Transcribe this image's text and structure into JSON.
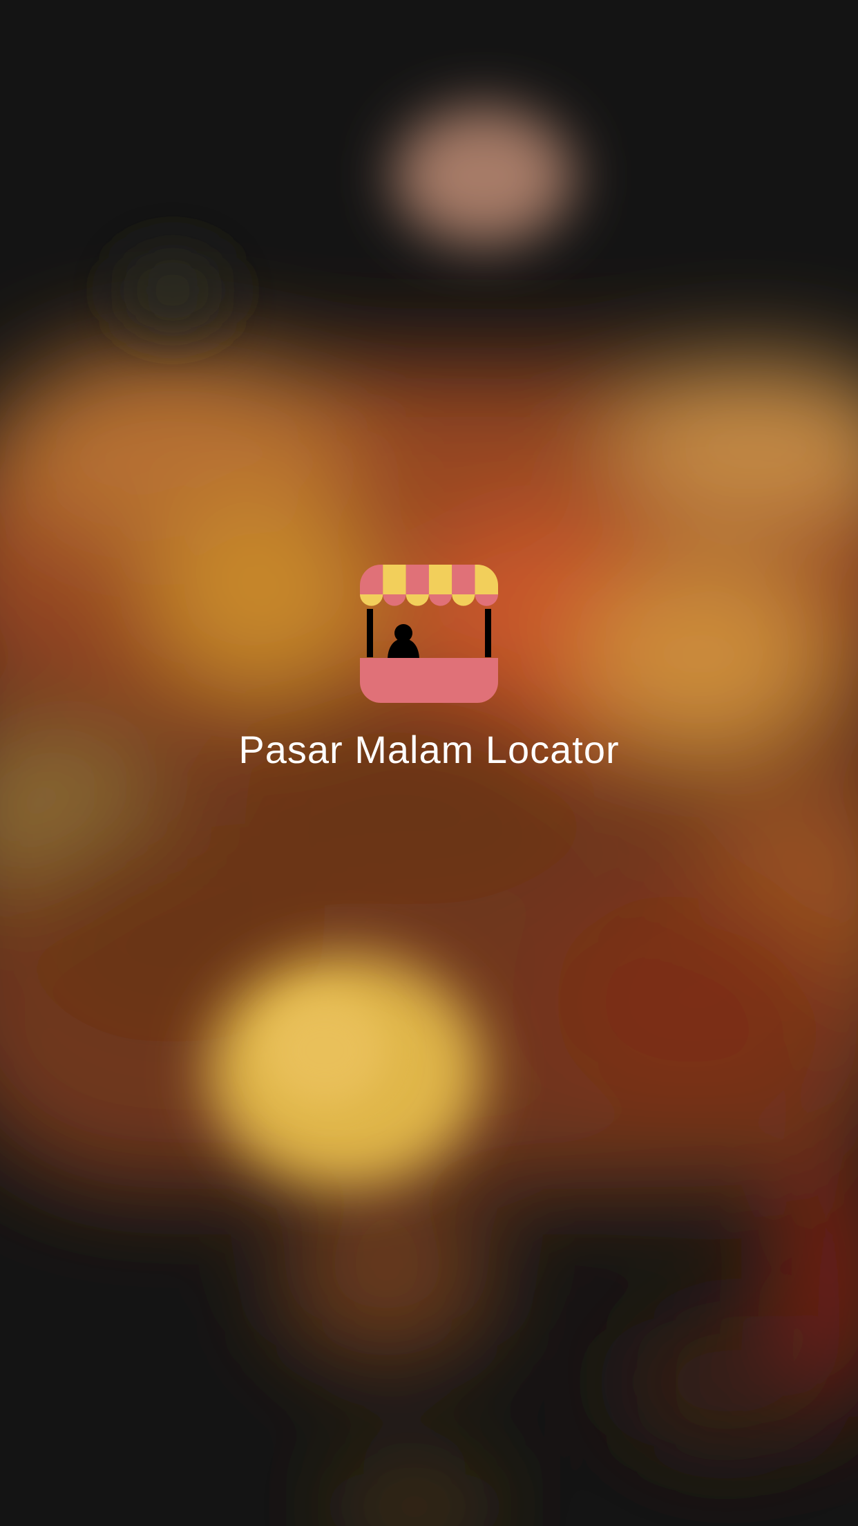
{
  "splash": {
    "app_name": "Pasar Malam Locator",
    "logo_icon": "market-stall-icon"
  },
  "colors": {
    "background": "#141414",
    "title_text": "#ffffff",
    "awning_pink": "#e07178",
    "awning_yellow": "#f2cf5b",
    "stall_pink": "#e07178",
    "vendor_black": "#000000"
  }
}
